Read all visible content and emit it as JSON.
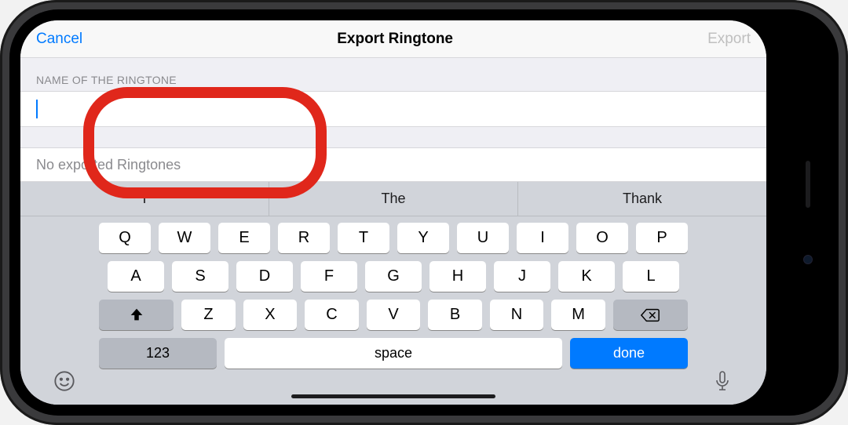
{
  "nav": {
    "cancel": "Cancel",
    "title": "Export Ringtone",
    "export": "Export"
  },
  "form": {
    "section_header": "NAME OF THE RINGTONE",
    "status_text": "No exported Ringtones"
  },
  "keyboard": {
    "suggest": [
      "I",
      "The",
      "Thank"
    ],
    "row1": [
      "Q",
      "W",
      "E",
      "R",
      "T",
      "Y",
      "U",
      "I",
      "O",
      "P"
    ],
    "row2": [
      "A",
      "S",
      "D",
      "F",
      "G",
      "H",
      "J",
      "K",
      "L"
    ],
    "row3": [
      "Z",
      "X",
      "C",
      "V",
      "B",
      "N",
      "M"
    ],
    "num_key": "123",
    "space_key": "space",
    "done_key": "done"
  }
}
